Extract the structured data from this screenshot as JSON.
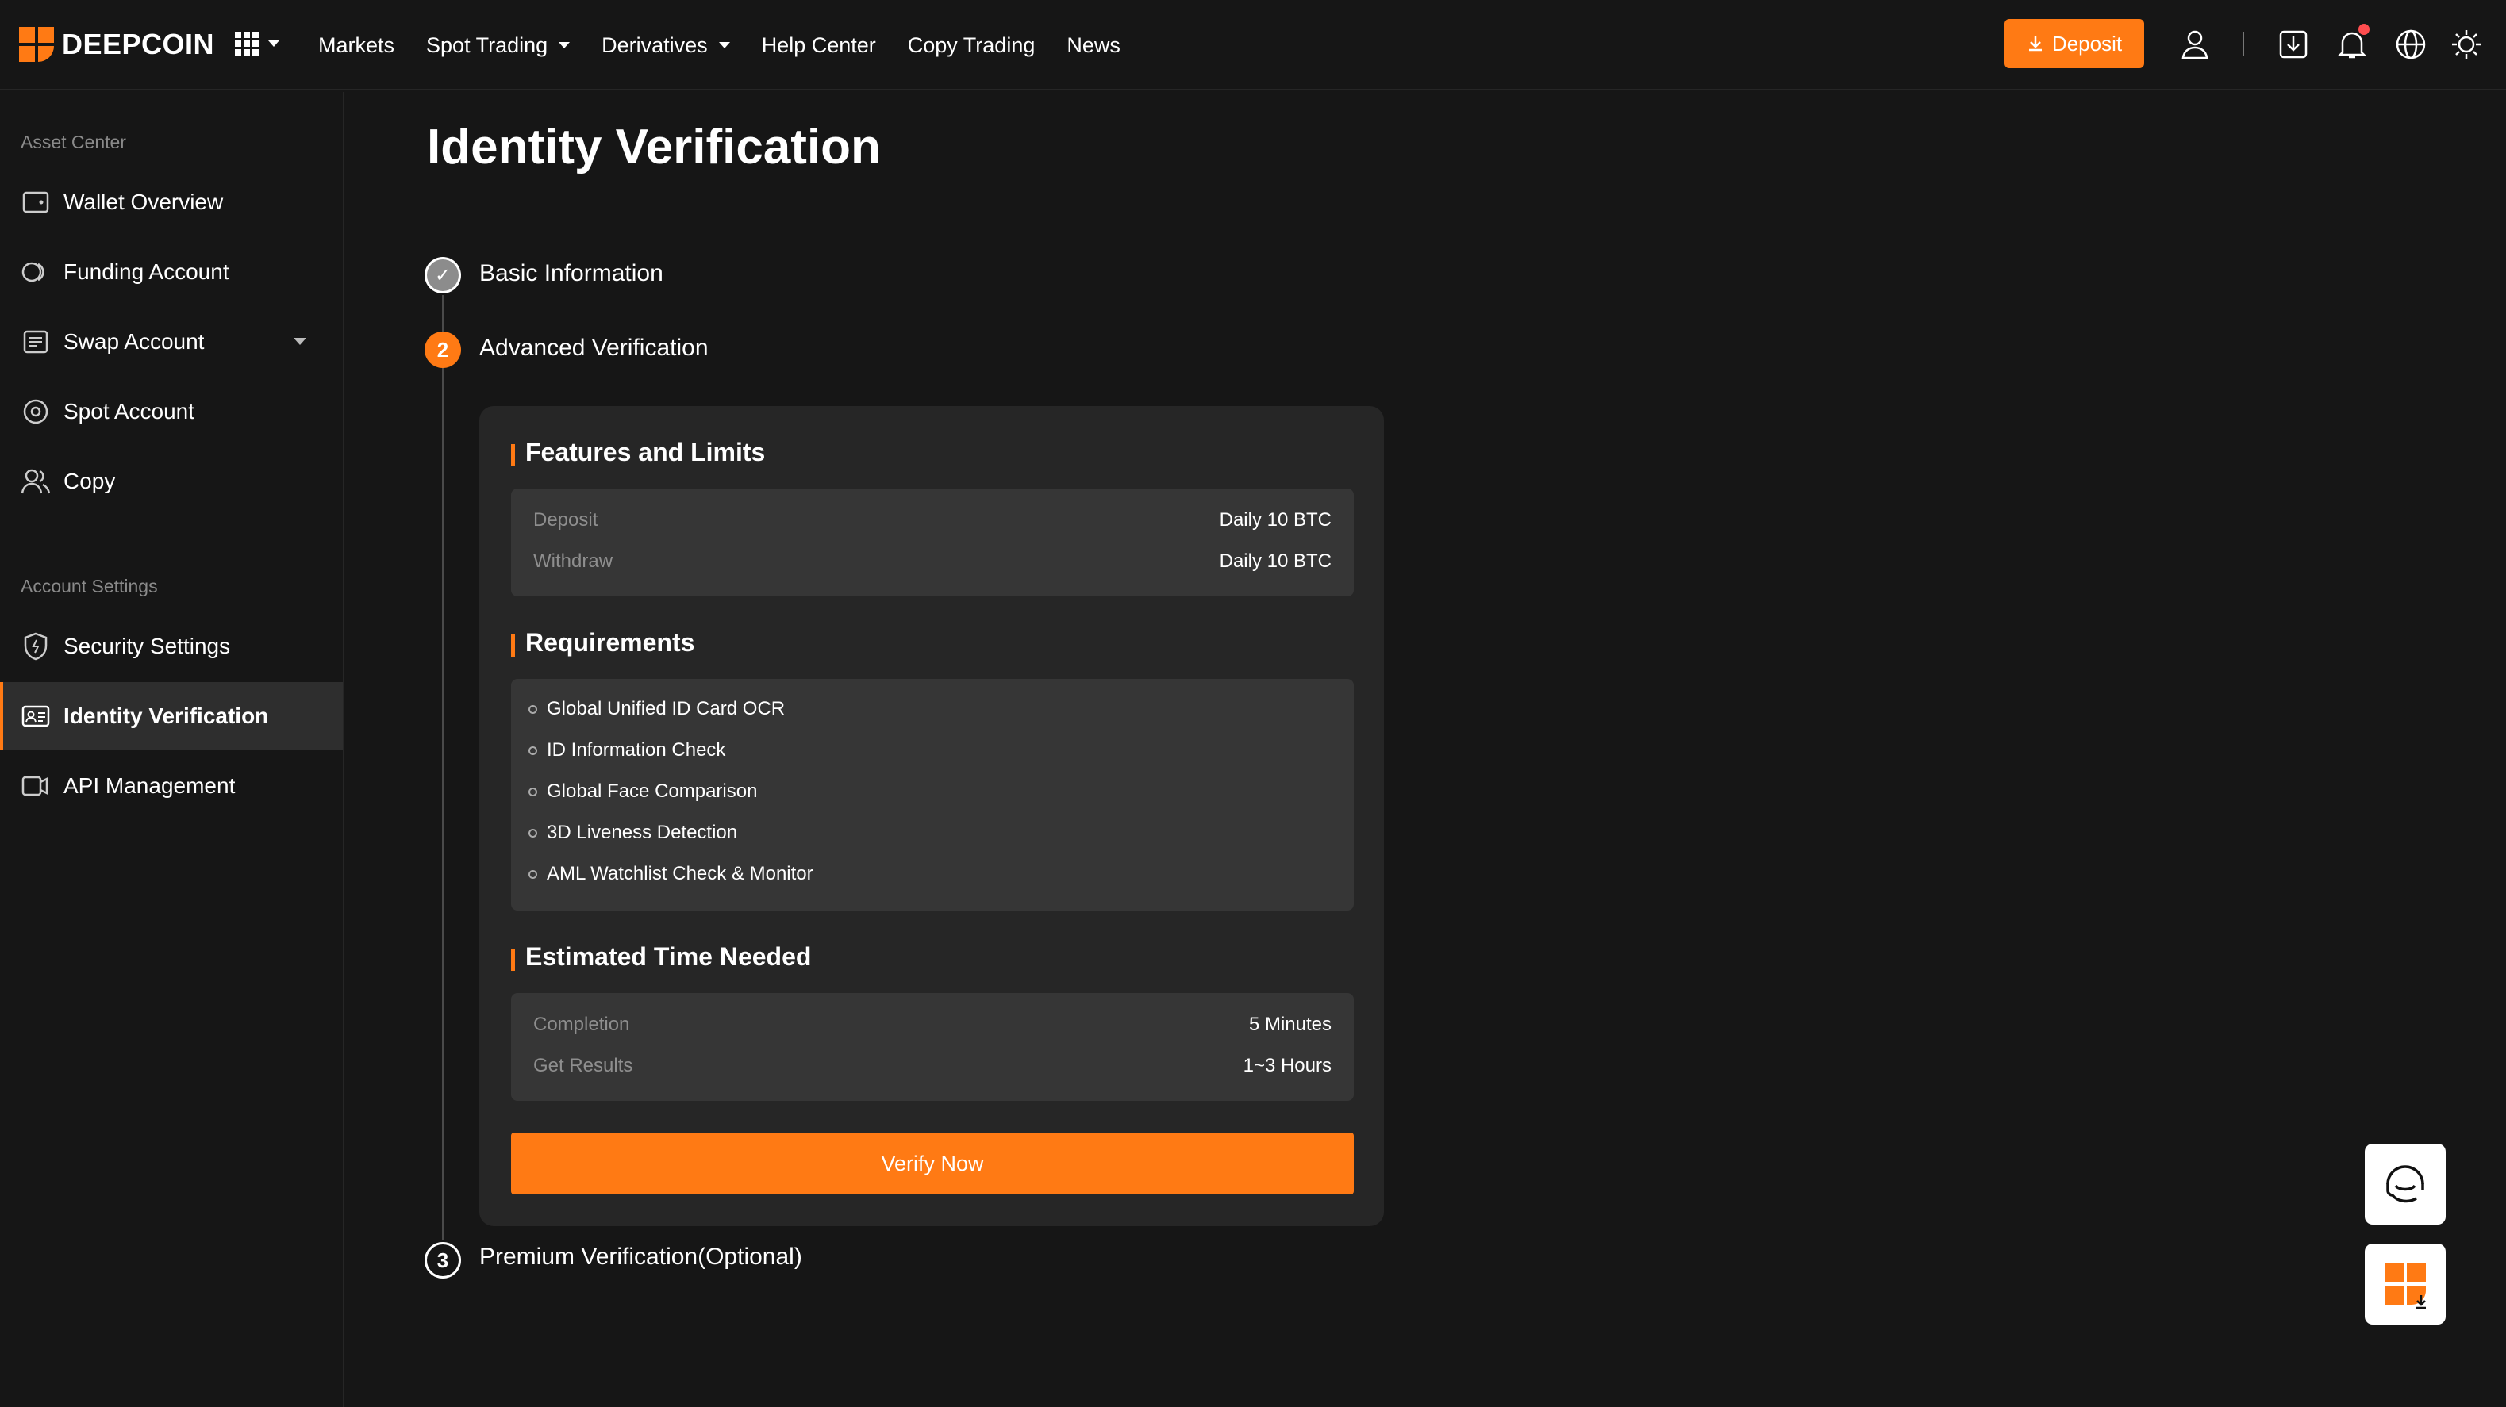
{
  "brand": {
    "name": "DEEPCOIN",
    "accent": "#ff7a14"
  },
  "nav": {
    "items": [
      {
        "label": "Markets",
        "dropdown": false
      },
      {
        "label": "Spot Trading",
        "dropdown": true
      },
      {
        "label": "Derivatives",
        "dropdown": true
      },
      {
        "label": "Help Center",
        "dropdown": false
      },
      {
        "label": "Copy Trading",
        "dropdown": false
      },
      {
        "label": "News",
        "dropdown": false
      }
    ],
    "deposit_label": "Deposit",
    "icons": [
      "user-icon",
      "download-icon",
      "bell-icon",
      "globe-icon",
      "theme-sun-icon"
    ]
  },
  "sidebar": {
    "asset_section": "Asset Center",
    "asset_items": [
      {
        "label": "Wallet Overview",
        "icon": "wallet-icon"
      },
      {
        "label": "Funding Account",
        "icon": "funding-icon"
      },
      {
        "label": "Swap Account",
        "icon": "swap-icon"
      },
      {
        "label": "Spot Account",
        "icon": "spot-icon"
      },
      {
        "label": "Copy",
        "icon": "copy-users-icon"
      }
    ],
    "settings_section": "Account Settings",
    "settings_items": [
      {
        "label": "Security Settings",
        "icon": "shield-icon"
      },
      {
        "label": "Identity Verification",
        "icon": "id-card-icon",
        "active": true
      },
      {
        "label": "API Management",
        "icon": "api-icon"
      }
    ]
  },
  "main": {
    "title": "Identity Verification",
    "steps": [
      {
        "number": "1",
        "label": "Basic Information",
        "status": "done"
      },
      {
        "number": "2",
        "label": "Advanced Verification",
        "status": "active"
      },
      {
        "number": "3",
        "label": "Premium Verification(Optional)",
        "status": "todo"
      }
    ],
    "features": {
      "title": "Features and Limits",
      "rows": [
        {
          "key": "Deposit",
          "value": "Daily 10 BTC"
        },
        {
          "key": "Withdraw",
          "value": "Daily 10 BTC"
        }
      ]
    },
    "requirements": {
      "title": "Requirements",
      "items": [
        "Global Unified ID Card OCR",
        "ID Information Check",
        "Global Face Comparison",
        "3D Liveness Detection",
        "AML Watchlist Check & Monitor"
      ]
    },
    "time": {
      "title": "Estimated Time Needed",
      "rows": [
        {
          "key": "Completion",
          "value": "5 Minutes"
        },
        {
          "key": "Get Results",
          "value": "1~3 Hours"
        }
      ]
    },
    "verify_label": "Verify Now"
  }
}
